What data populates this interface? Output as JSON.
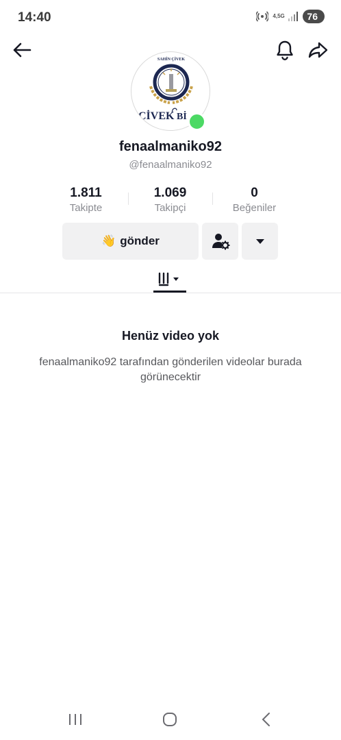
{
  "status_bar": {
    "time": "14:40",
    "network_label": "4,5G",
    "battery": "76"
  },
  "profile": {
    "display_name": "fenaalmaniko92",
    "handle": "@fenaalmaniko92",
    "avatar_text_top": "SAHİN ÇİVEK",
    "avatar_text_main": "ÇİVEK ",
    "avatar_text_tail": "Bİ"
  },
  "stats": [
    {
      "value": "1.811",
      "label": "Takipte"
    },
    {
      "value": "1.069",
      "label": "Takipçi"
    },
    {
      "value": "0",
      "label": "Beğeniler"
    }
  ],
  "actions": {
    "send_emoji": "👋",
    "send_label": "gönder"
  },
  "empty_state": {
    "title": "Henüz video yok",
    "description": "fenaalmaniko92 tarafından gönderilen videolar burada görünecektir"
  },
  "icons": {
    "back": "arrow-left-icon",
    "bell": "bell-icon",
    "share": "share-icon",
    "add_user": "user-settings-icon",
    "dropdown": "caret-down-icon",
    "videos_tab": "grid-lines-icon"
  },
  "colors": {
    "online": "#4cd964",
    "button_bg": "#f1f1f2",
    "text_primary": "#161823",
    "text_secondary": "#8a8b91"
  }
}
